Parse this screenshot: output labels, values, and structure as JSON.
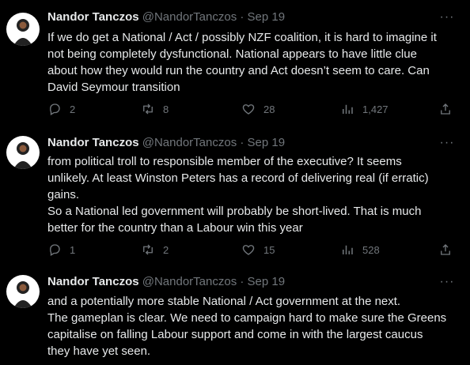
{
  "tweets": [
    {
      "name": "Nandor Tanczos",
      "handle": "@NandorTanczos",
      "separator": "·",
      "date": "Sep 19",
      "lines": [
        "If we do get a National / Act / possibly NZF coalition, it is hard to imagine it",
        "not being completely dysfunctional. National appears to have little clue",
        "about how they would run the country and Act doesn’t seem to care. Can",
        "David Seymour transition"
      ],
      "replies": "2",
      "retweets": "8",
      "likes": "28",
      "views": "1,427"
    },
    {
      "name": "Nandor Tanczos",
      "handle": "@NandorTanczos",
      "separator": "·",
      "date": "Sep 19",
      "lines": [
        "from political troll to responsible member of the executive? It seems",
        "unlikely. At least Winston Peters has a record of delivering real (if erratic)",
        "gains.",
        "So a National led government will probably be short-lived. That is much",
        "better for the country than a Labour win this year"
      ],
      "replies": "1",
      "retweets": "2",
      "likes": "15",
      "views": "528"
    },
    {
      "name": "Nandor Tanczos",
      "handle": "@NandorTanczos",
      "separator": "·",
      "date": "Sep 19",
      "lines": [
        "and a potentially more stable National / Act government at the next.",
        "The gameplan is clear. We need to campaign hard to make sure the Greens",
        "capitalise on falling Labour support and come in with the largest caucus",
        "they have yet seen."
      ]
    }
  ],
  "more_glyph": "···",
  "colors": {
    "background": "#000000",
    "text": "#e7e9ea",
    "muted": "#71767b"
  }
}
